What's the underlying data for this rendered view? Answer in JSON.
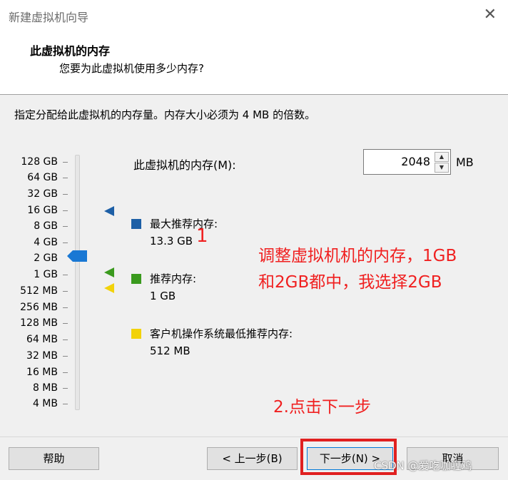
{
  "window": {
    "title": "新建虚拟机向导",
    "close_glyph": "✕"
  },
  "header": {
    "title": "此虚拟机的内存",
    "subtitle": "您要为此虚拟机使用多少内存?"
  },
  "instruction": "指定分配给此虚拟机的内存量。内存大小必须为 4 MB 的倍数。",
  "memory_scale": {
    "labels": [
      "128 GB",
      "64 GB",
      "32 GB",
      "16 GB",
      "8 GB",
      "4 GB",
      "2 GB",
      "1 GB",
      "512 MB",
      "256 MB",
      "128 MB",
      "64 MB",
      "32 MB",
      "16 MB",
      "8 MB",
      "4 MB"
    ],
    "selected": "2 GB"
  },
  "memory_input": {
    "label": "此虚拟机的内存(M):",
    "value": "2048",
    "unit": "MB",
    "up_glyph": "▲",
    "down_glyph": "▼"
  },
  "legend": {
    "max_recommended": {
      "title": "最大推荐内存:",
      "value": "13.3 GB",
      "color": "#1d5fa6"
    },
    "recommended": {
      "title": "推荐内存:",
      "value": "1 GB",
      "color": "#3a9a1e"
    },
    "guest_min": {
      "title": "客户机操作系统最低推荐内存:",
      "value": "512 MB",
      "color": "#f2d20a"
    }
  },
  "annotations": {
    "marker_1": "1",
    "note_line1": "调整虚拟机机的内存，1GB",
    "note_line2": "和2GB都中，我选择2GB",
    "step_2": "2.点击下一步",
    "color": "#f02020"
  },
  "buttons": {
    "help": "帮助",
    "back": "< 上一步(B)",
    "next": "下一步(N) >",
    "cancel": "取消"
  },
  "watermark": "CSDN @爱吃咖喱鸡"
}
